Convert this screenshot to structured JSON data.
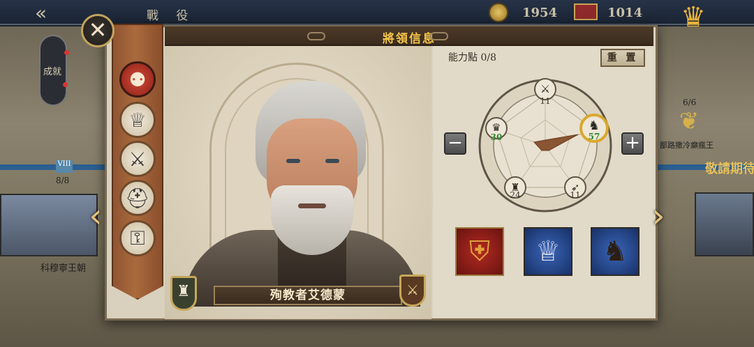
{
  "background": {
    "screen_title": "戰 役",
    "coins": "1954",
    "flags": "1014",
    "achievement_label": "成就",
    "left_card": {
      "version": "VIII",
      "count": "8/8",
      "label": "科穆寧王朝"
    },
    "right_card": {
      "count": "6/6",
      "label": "鄙路撒冷癲瘋王",
      "banner": "敬請期待"
    }
  },
  "dialog": {
    "title": "將領信息",
    "close_icon": "close-icon",
    "sidebar_tabs": [
      {
        "name": "attributes-tab",
        "icon": "strength-icon",
        "active": true
      },
      {
        "name": "crown-tab",
        "icon": "crown-icon",
        "active": false
      },
      {
        "name": "sword-tab",
        "icon": "sword-icon",
        "active": false
      },
      {
        "name": "helmet-tab",
        "icon": "helmet-icon",
        "active": false
      },
      {
        "name": "locked-tab",
        "icon": "lock-icon",
        "active": false
      }
    ],
    "general": {
      "name": "殉教者艾德蒙",
      "left_badge_icon": "tower-icon",
      "right_badge_icon": "crossed-swords-icon"
    },
    "stats": {
      "points_label": "能力點 0/8",
      "reset_label": "重 置",
      "minus_label": "−",
      "plus_label": "+",
      "attributes": [
        {
          "name": "sword",
          "value": "11",
          "icon": "crossed-swords-icon"
        },
        {
          "name": "cavalry",
          "value": "57",
          "icon": "horse-icon",
          "selected": true
        },
        {
          "name": "archery",
          "value": "11",
          "icon": "bow-icon"
        },
        {
          "name": "castle",
          "value": "24",
          "icon": "castle-icon"
        },
        {
          "name": "crown",
          "value": "30",
          "icon": "crown-icon"
        }
      ]
    },
    "equipment": [
      {
        "name": "shield-item",
        "icon": "lion-shield-icon"
      },
      {
        "name": "crown-item",
        "icon": "tiara-icon"
      },
      {
        "name": "horse-item",
        "icon": "horse-icon"
      }
    ],
    "colors": {
      "title_gold": "#f2c34b",
      "highlight_green": "#2d8a2d",
      "selected_ring": "#d9a82c"
    }
  }
}
